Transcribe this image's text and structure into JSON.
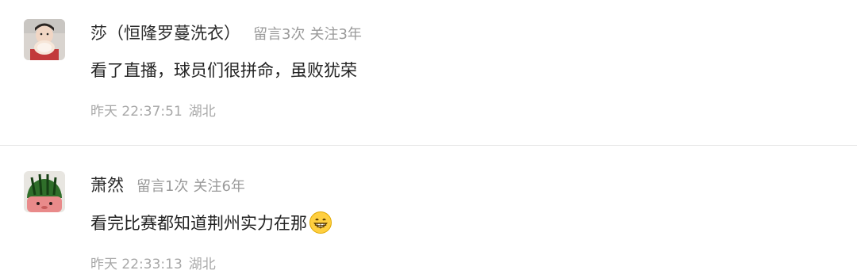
{
  "comments": [
    {
      "nickname": "莎（恒隆罗蔓洗衣）",
      "message_count": "留言3次",
      "follow_duration": "关注3年",
      "content": "看了直播，球员们很拼命，虽败犹荣",
      "time": "昨天 22:37:51",
      "location": "湖北",
      "avatar_icon": "child-holding-bread-avatar"
    },
    {
      "nickname": "萧然",
      "message_count": "留言1次",
      "follow_duration": "关注6年",
      "content": "看完比赛都知道荆州实力在那",
      "emoji": "grinning-face-icon",
      "time": "昨天 22:33:13",
      "location": "湖北",
      "avatar_icon": "watermelon-avatar"
    }
  ]
}
